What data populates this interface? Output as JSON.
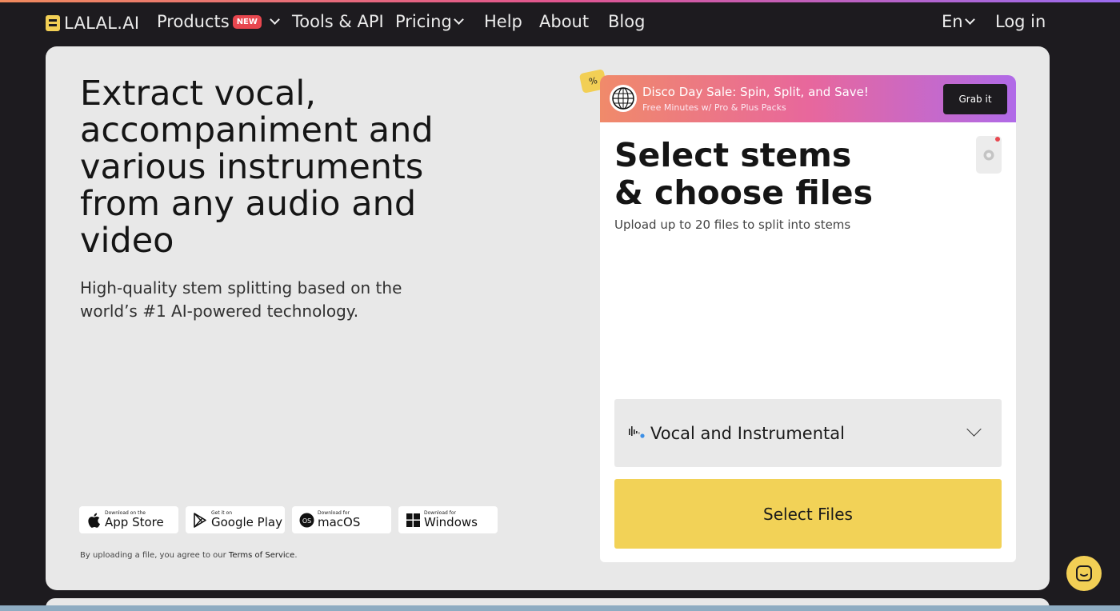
{
  "nav": {
    "logo": "LALAL.AI",
    "products": "Products",
    "new_badge": "NEW",
    "tools": "Tools & API",
    "pricing": "Pricing",
    "help": "Help",
    "about": "About",
    "blog": "Blog",
    "language": "En",
    "login": "Log in"
  },
  "hero": {
    "title": "Extract vocal, accompaniment and various instruments from any audio and video",
    "subtitle": "High-quality stem splitting based on the world’s #1 AI-powered technology."
  },
  "downloads": [
    {
      "small": "Download on the",
      "big": "App Store",
      "icon": "apple-icon"
    },
    {
      "small": "Get it on",
      "big": "Google Play",
      "icon": "google-play-icon"
    },
    {
      "small": "Download for",
      "big": "macOS",
      "icon": "macos-icon"
    },
    {
      "small": "Download for",
      "big": "Windows",
      "icon": "windows-icon"
    }
  ],
  "terms": {
    "prefix": "By uploading a file, you agree to our ",
    "link": "Terms of Service",
    "suffix": "."
  },
  "promo": {
    "tag": "%",
    "title": "Disco Day Sale: Spin, Split, and Save!",
    "subtitle": "Free Minutes w/ Pro & Plus Packs",
    "button": "Grab it"
  },
  "upload": {
    "title": "Select stems & choose files",
    "subtitle": "Upload up to 20 files to split into stems",
    "stem_option": "Vocal and Instrumental",
    "select_button": "Select Files"
  },
  "colors": {
    "accent_yellow": "#f2d257",
    "background": "#1d1b1f",
    "card": "#e8e8e8"
  }
}
